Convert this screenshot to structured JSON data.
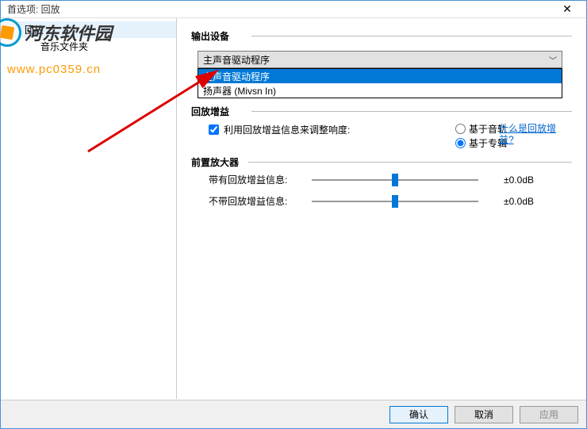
{
  "window": {
    "title": "首选项: 回放"
  },
  "sidebar": {
    "items": [
      {
        "label": "回放",
        "selected": true
      },
      {
        "label": "音乐文件夹",
        "selected": false
      }
    ]
  },
  "output_device": {
    "legend": "输出设备",
    "selected": "主声音驱动程序",
    "options": [
      {
        "label": "主声音驱动程序",
        "highlighted": true
      },
      {
        "label": "扬声器 (Mivsn In)",
        "highlighted": false
      }
    ]
  },
  "replay_gain": {
    "legend": "回放增益",
    "checkbox_label": "利用回放增益信息来调整响度:",
    "checked": true,
    "radios": {
      "track": "基于音轨",
      "album": "基于专辑",
      "selected": "album"
    },
    "help_link": "什么是回放增益?"
  },
  "preamp": {
    "legend": "前置放大器",
    "sliders": [
      {
        "label": "带有回放增益信息:",
        "value": "±0.0dB"
      },
      {
        "label": "不带回放增益信息:",
        "value": "±0.0dB"
      }
    ]
  },
  "buttons": {
    "ok": "确认",
    "cancel": "取消",
    "apply": "应用"
  },
  "watermark": {
    "text": "河东软件园",
    "url": "www.pc0359.cn"
  }
}
